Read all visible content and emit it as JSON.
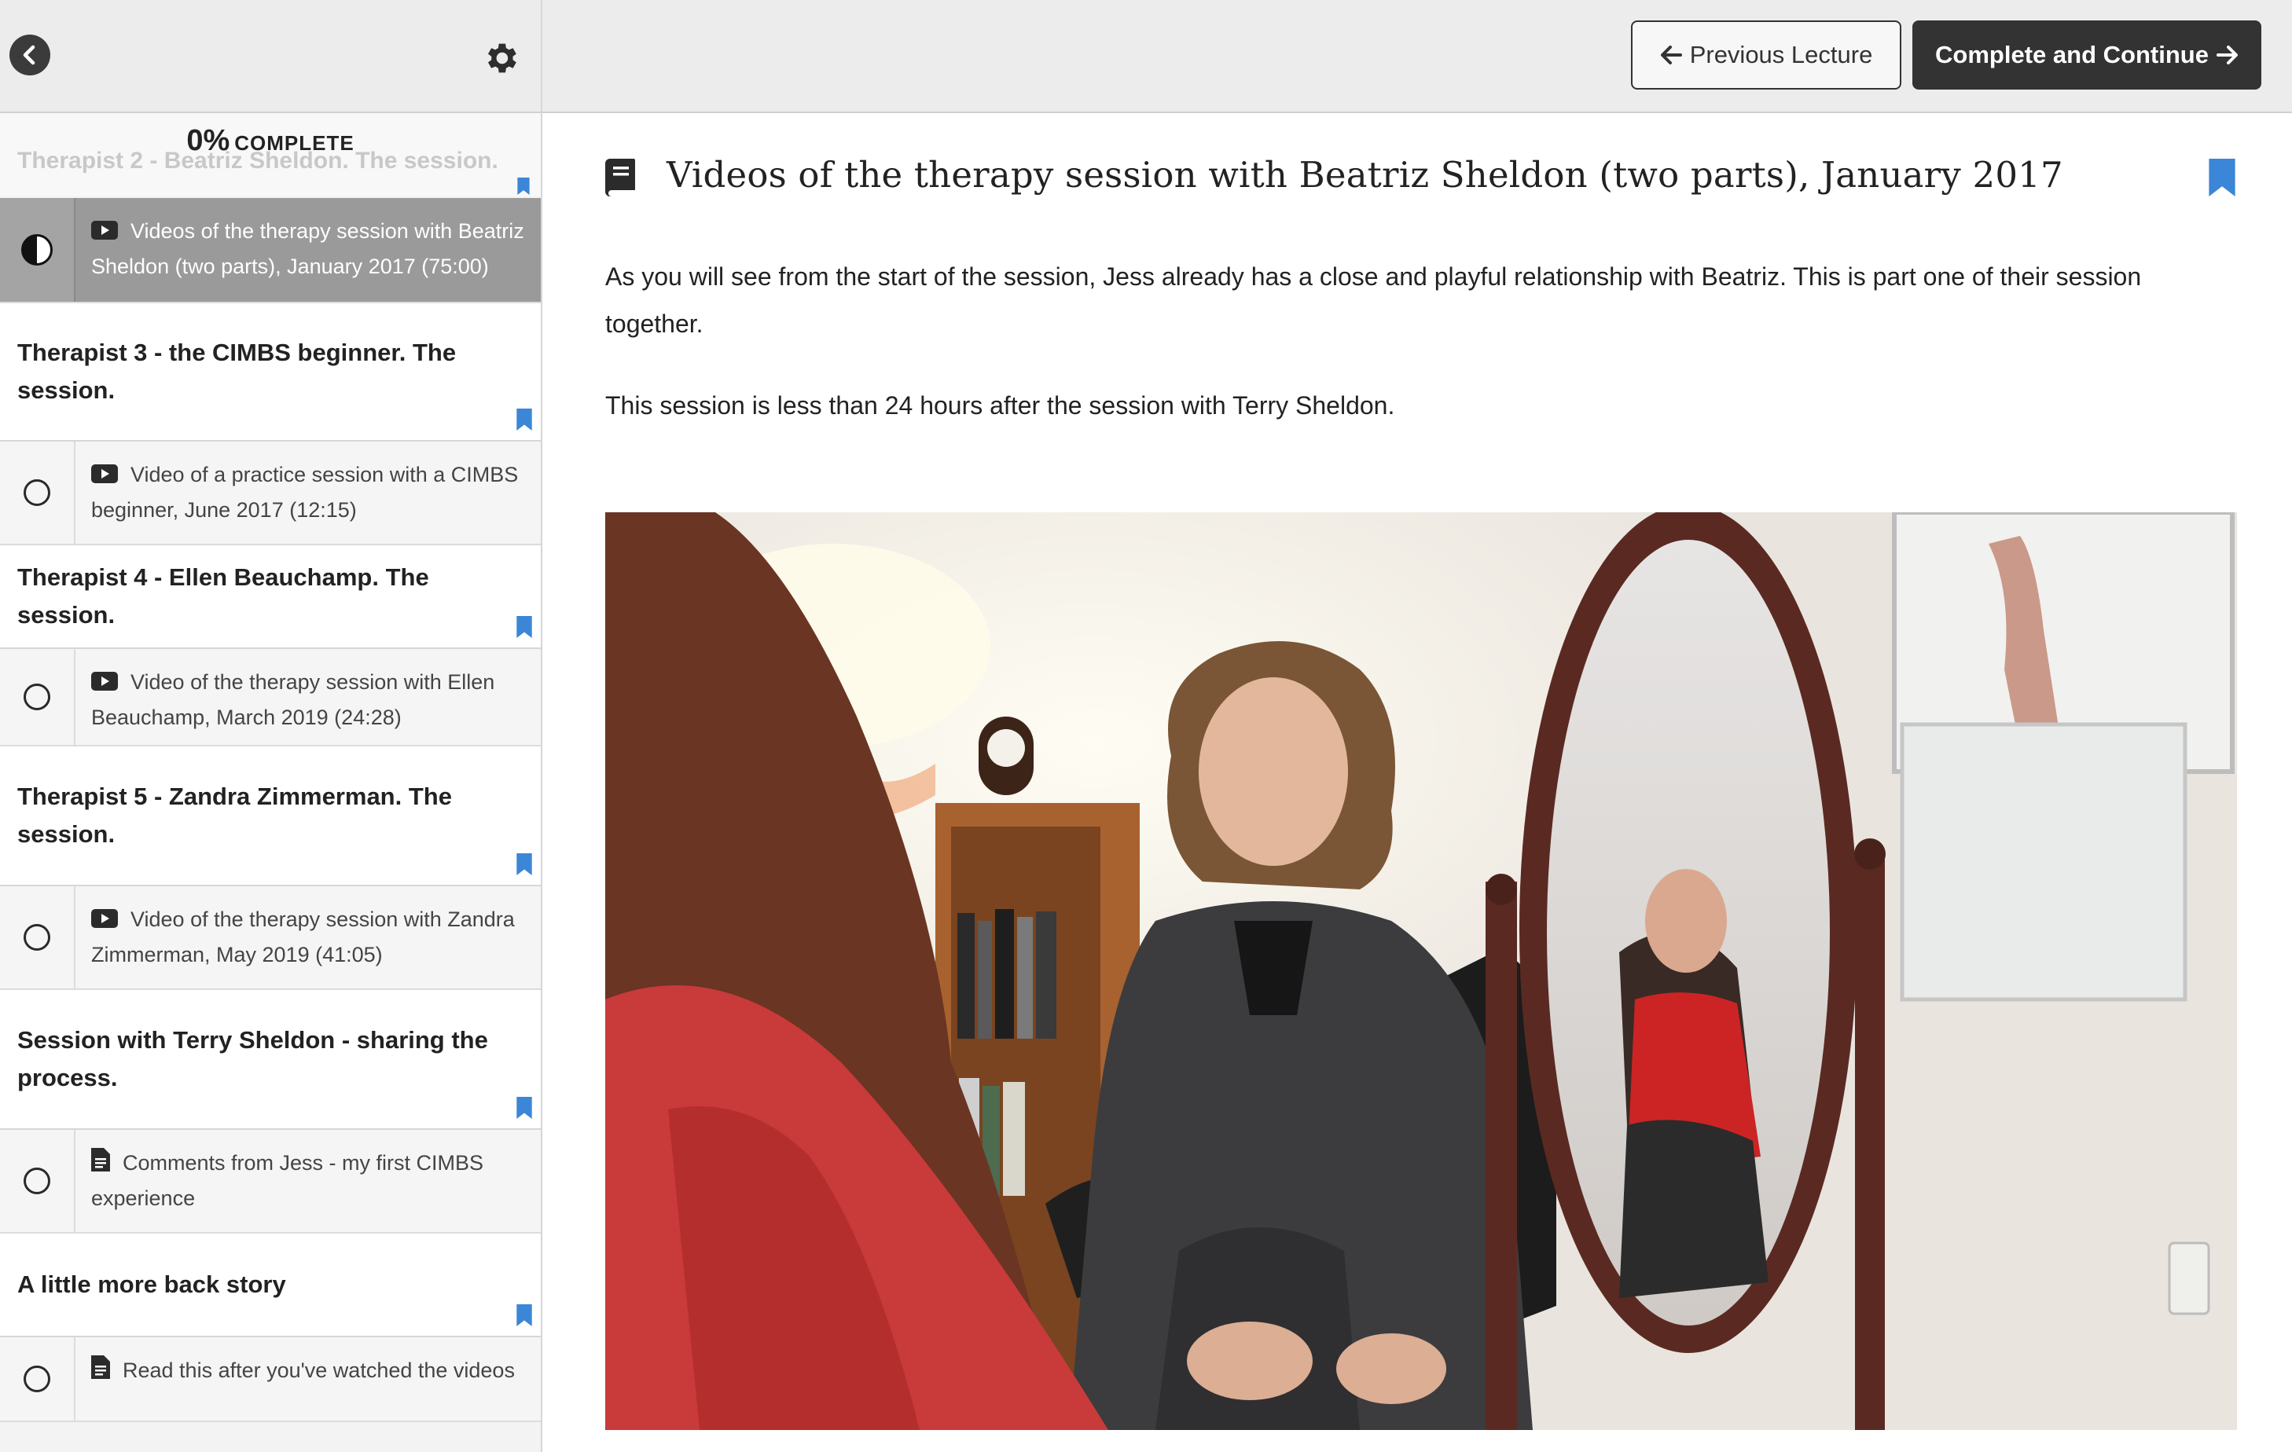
{
  "sidebar": {
    "progress": {
      "percent": "0%",
      "label": "COMPLETE"
    },
    "faded_section": "Therapist 2 - Beatriz Sheldon. The session.",
    "rows": [
      {
        "kind": "lecture",
        "active": true,
        "status": "in-progress",
        "icon": "video-icon",
        "text": "Videos of the therapy session with Beatriz Sheldon (two parts), January 2017 (75:00)"
      },
      {
        "kind": "section",
        "text": "Therapist 3 - the CIMBS beginner. The session."
      },
      {
        "kind": "lecture",
        "status": "incomplete",
        "icon": "video-icon",
        "text": "Video of a practice session with a CIMBS beginner, June 2017 (12:15)"
      },
      {
        "kind": "section",
        "text": "Therapist 4 - Ellen Beauchamp. The session."
      },
      {
        "kind": "lecture",
        "status": "incomplete",
        "icon": "video-icon",
        "text": "Video of the therapy session with Ellen Beauchamp, March 2019 (24:28)"
      },
      {
        "kind": "section",
        "text": "Therapist 5 - Zandra Zimmerman. The session."
      },
      {
        "kind": "lecture",
        "status": "incomplete",
        "icon": "video-icon",
        "text": "Video of the therapy session with Zandra Zimmerman, May 2019 (41:05)"
      },
      {
        "kind": "section",
        "text": "Session with Terry Sheldon - sharing the process."
      },
      {
        "kind": "lecture",
        "status": "incomplete",
        "icon": "document-icon",
        "text": "Comments from Jess - my first CIMBS experience"
      },
      {
        "kind": "section",
        "text": "A little more back story"
      },
      {
        "kind": "lecture",
        "status": "incomplete",
        "icon": "document-icon",
        "text": "Read this after you've watched the videos"
      }
    ]
  },
  "topbar": {
    "prev_label": "Previous Lecture",
    "next_label": "Complete and Continue"
  },
  "lecture": {
    "title": "Videos of the therapy session with Beatriz Sheldon (two parts), January 2017",
    "paragraphs": [
      "As you will see from the start of the session, Jess already has a close and playful relationship with Beatriz. This is part one of their session together.",
      "This session is less than 24 hours after the session with Terry Sheldon."
    ]
  },
  "colors": {
    "accent_bookmark": "#3b86d6",
    "dark_button": "#333333",
    "active_row": "#9a9a9a"
  }
}
